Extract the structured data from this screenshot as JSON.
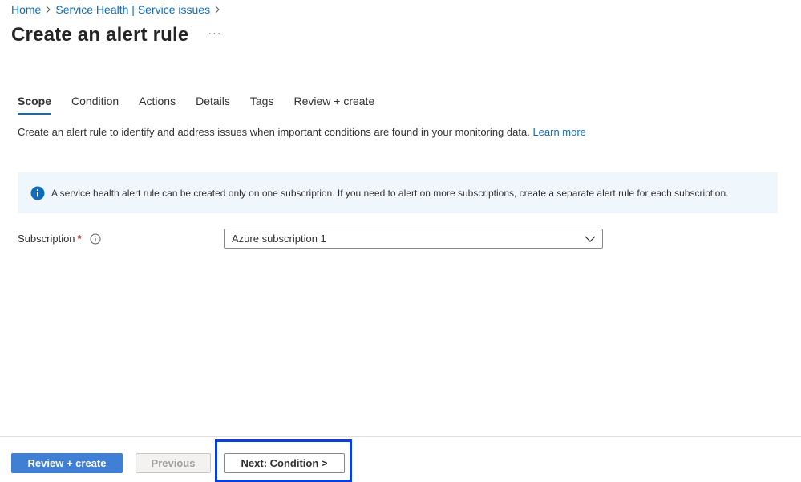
{
  "breadcrumb": {
    "items": [
      "Home",
      "Service Health | Service issues"
    ]
  },
  "header": {
    "title": "Create an alert rule",
    "more_label": "···"
  },
  "tabs": [
    {
      "label": "Scope",
      "active": true
    },
    {
      "label": "Condition",
      "active": false
    },
    {
      "label": "Actions",
      "active": false
    },
    {
      "label": "Details",
      "active": false
    },
    {
      "label": "Tags",
      "active": false
    },
    {
      "label": "Review + create",
      "active": false
    }
  ],
  "scope": {
    "description": "Create an alert rule to identify and address issues when important conditions are found in your monitoring data.",
    "learn_more": "Learn more",
    "info_banner": "A service health alert rule can be created only on one subscription. If you need to alert on more subscriptions, create a separate alert rule for each subscription.",
    "subscription": {
      "label": "Subscription",
      "required_mark": "*",
      "value": "Azure subscription 1"
    }
  },
  "footer": {
    "review_create": "Review + create",
    "previous": "Previous",
    "next": "Next: Condition >"
  },
  "colors": {
    "link": "#0f6cbd",
    "primary_button": "#3f7fd6",
    "info_background": "#eff6fc",
    "highlight": "#0a3fdb",
    "required": "#a4262c"
  },
  "icons": {
    "breadcrumb_separator": "chevron-right-icon",
    "info": "info-icon",
    "tooltip": "info-outline-icon",
    "dropdown": "chevron-down-icon"
  }
}
